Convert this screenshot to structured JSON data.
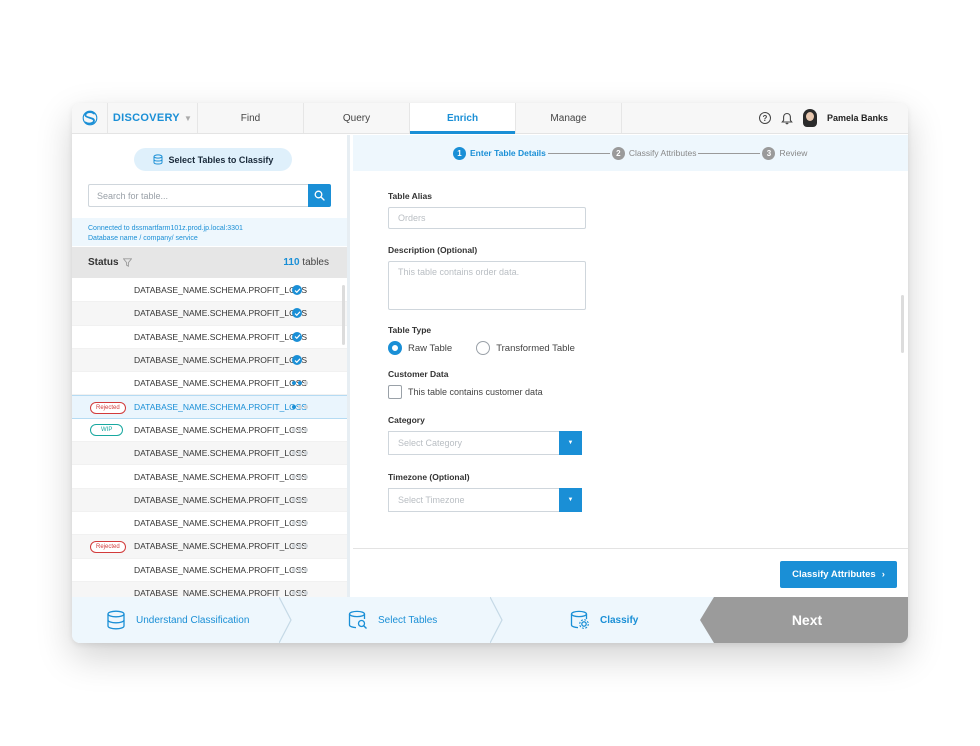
{
  "app": {
    "brand": "DISCOVERY",
    "nav_tabs": [
      {
        "label": "Find"
      },
      {
        "label": "Query"
      },
      {
        "label": "Enrich"
      },
      {
        "label": "Manage"
      }
    ],
    "active_tab": "Enrich",
    "user": "Pamela Banks"
  },
  "left": {
    "select_tables_label": "Select Tables to Classify",
    "search_placeholder": "Search for table...",
    "connection_line1": "Connected to dssmartfarm101z.prod.jp.local:3301",
    "connection_line2": "Database name / company/ service",
    "status_header": "Status",
    "table_count": "110",
    "table_count_suffix": " tables",
    "rows": [
      {
        "name": "DATABASE_NAME.SCHEMA.PROFIT_LOSS",
        "badge": "",
        "state": "done"
      },
      {
        "name": "DATABASE_NAME.SCHEMA.PROFIT_LOSS",
        "badge": "",
        "state": "done"
      },
      {
        "name": "DATABASE_NAME.SCHEMA.PROFIT_LOSS",
        "badge": "",
        "state": "done"
      },
      {
        "name": "DATABASE_NAME.SCHEMA.PROFIT_LOSS",
        "badge": "",
        "state": "done"
      },
      {
        "name": "DATABASE_NAME.SCHEMA.PROFIT_LOSS",
        "badge": "",
        "state": "2/3"
      },
      {
        "name": "DATABASE_NAME.SCHEMA.PROFIT_LOSS",
        "badge": "Rejected",
        "state": "1/3"
      },
      {
        "name": "DATABASE_NAME.SCHEMA.PROFIT_LOSS",
        "badge": "WIP",
        "state": "0/3"
      },
      {
        "name": "DATABASE_NAME.SCHEMA.PROFIT_LOSS",
        "badge": "",
        "state": "0/3"
      },
      {
        "name": "DATABASE_NAME.SCHEMA.PROFIT_LOSS",
        "badge": "",
        "state": "0/3"
      },
      {
        "name": "DATABASE_NAME.SCHEMA.PROFIT_LOSS",
        "badge": "",
        "state": "0/3"
      },
      {
        "name": "DATABASE_NAME.SCHEMA.PROFIT_LOSS",
        "badge": "",
        "state": "0/3"
      },
      {
        "name": "DATABASE_NAME.SCHEMA.PROFIT_LOSS",
        "badge": "Rejected",
        "state": "0/3"
      },
      {
        "name": "DATABASE_NAME.SCHEMA.PROFIT_LOSS",
        "badge": "",
        "state": "0/3"
      },
      {
        "name": "DATABASE_NAME.SCHEMA.PROFIT_LOSS",
        "badge": "",
        "state": "0/3"
      }
    ]
  },
  "stepper": {
    "steps": [
      {
        "num": "1",
        "label": "Enter Table Details"
      },
      {
        "num": "2",
        "label": "Classify Attributes"
      },
      {
        "num": "3",
        "label": "Review"
      }
    ]
  },
  "form": {
    "alias_label": "Table Alias",
    "alias_placeholder": "Orders",
    "description_label": "Description (Optional)",
    "description_placeholder": "This table contains order data.",
    "table_type_label": "Table Type",
    "table_type_options": [
      "Raw Table",
      "Transformed Table"
    ],
    "table_type_selected": "Raw Table",
    "customer_data_label": "Customer Data",
    "customer_data_checkbox": "This table contains customer data",
    "category_label": "Category",
    "category_placeholder": "Select Category",
    "timezone_label": "Timezone (Optional)",
    "timezone_placeholder": "Select Timezone",
    "classify_button": "Classify Attributes"
  },
  "wizard": {
    "steps": [
      {
        "label": "Understand Classification"
      },
      {
        "label": "Select Tables"
      },
      {
        "label": "Classify"
      }
    ],
    "next_label": "Next"
  },
  "colors": {
    "accent": "#1a8fd6",
    "rejected": "#d23b3b",
    "wip": "#18a8a0",
    "next_button": "#9b9b9b"
  }
}
